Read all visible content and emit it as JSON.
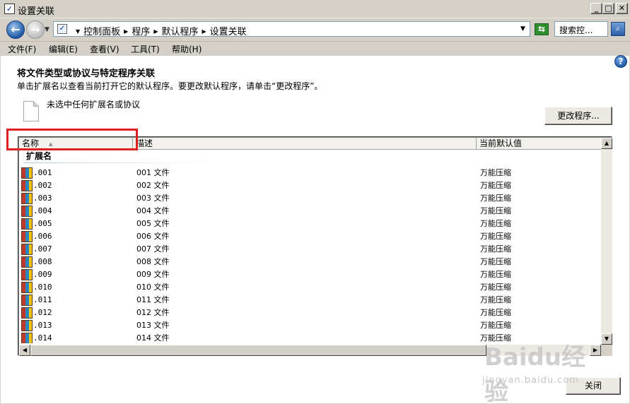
{
  "window": {
    "title": "设置关联"
  },
  "address": {
    "crumbs": [
      "控制面板",
      "程序",
      "默认程序",
      "设置关联"
    ],
    "search_placeholder": "搜索控..."
  },
  "menu": [
    {
      "label": "文件(F)"
    },
    {
      "label": "编辑(E)"
    },
    {
      "label": "查看(V)"
    },
    {
      "label": "工具(T)"
    },
    {
      "label": "帮助(H)"
    }
  ],
  "main": {
    "heading": "将文件类型或协议与特定程序关联",
    "subtext": "单击扩展名以查看当前打开它的默认程序。要更改默认程序，请单击“更改程序”。",
    "no_selection": "未选中任何扩展名或协议",
    "change_button": "更改程序...",
    "close_button": "关闭"
  },
  "table": {
    "columns": {
      "name": "名称",
      "desc": "描述",
      "default": "当前默认值"
    },
    "group": "扩展名",
    "rows": [
      {
        "name": ".001",
        "desc": "001 文件",
        "default": "万能压缩"
      },
      {
        "name": ".002",
        "desc": "002 文件",
        "default": "万能压缩"
      },
      {
        "name": ".003",
        "desc": "003 文件",
        "default": "万能压缩"
      },
      {
        "name": ".004",
        "desc": "004 文件",
        "default": "万能压缩"
      },
      {
        "name": ".005",
        "desc": "005 文件",
        "default": "万能压缩"
      },
      {
        "name": ".006",
        "desc": "006 文件",
        "default": "万能压缩"
      },
      {
        "name": ".007",
        "desc": "007 文件",
        "default": "万能压缩"
      },
      {
        "name": ".008",
        "desc": "008 文件",
        "default": "万能压缩"
      },
      {
        "name": ".009",
        "desc": "009 文件",
        "default": "万能压缩"
      },
      {
        "name": ".010",
        "desc": "010 文件",
        "default": "万能压缩"
      },
      {
        "name": ".011",
        "desc": "011 文件",
        "default": "万能压缩"
      },
      {
        "name": ".012",
        "desc": "012 文件",
        "default": "万能压缩"
      },
      {
        "name": ".013",
        "desc": "013 文件",
        "default": "万能压缩"
      },
      {
        "name": ".014",
        "desc": "014 文件",
        "default": "万能压缩"
      }
    ]
  },
  "watermark": {
    "logo": "Baidu经验",
    "url": "jingyan.baidu.com"
  },
  "colors": {
    "highlight_box": "#e02020",
    "window_bg": "#d4d0c8"
  }
}
